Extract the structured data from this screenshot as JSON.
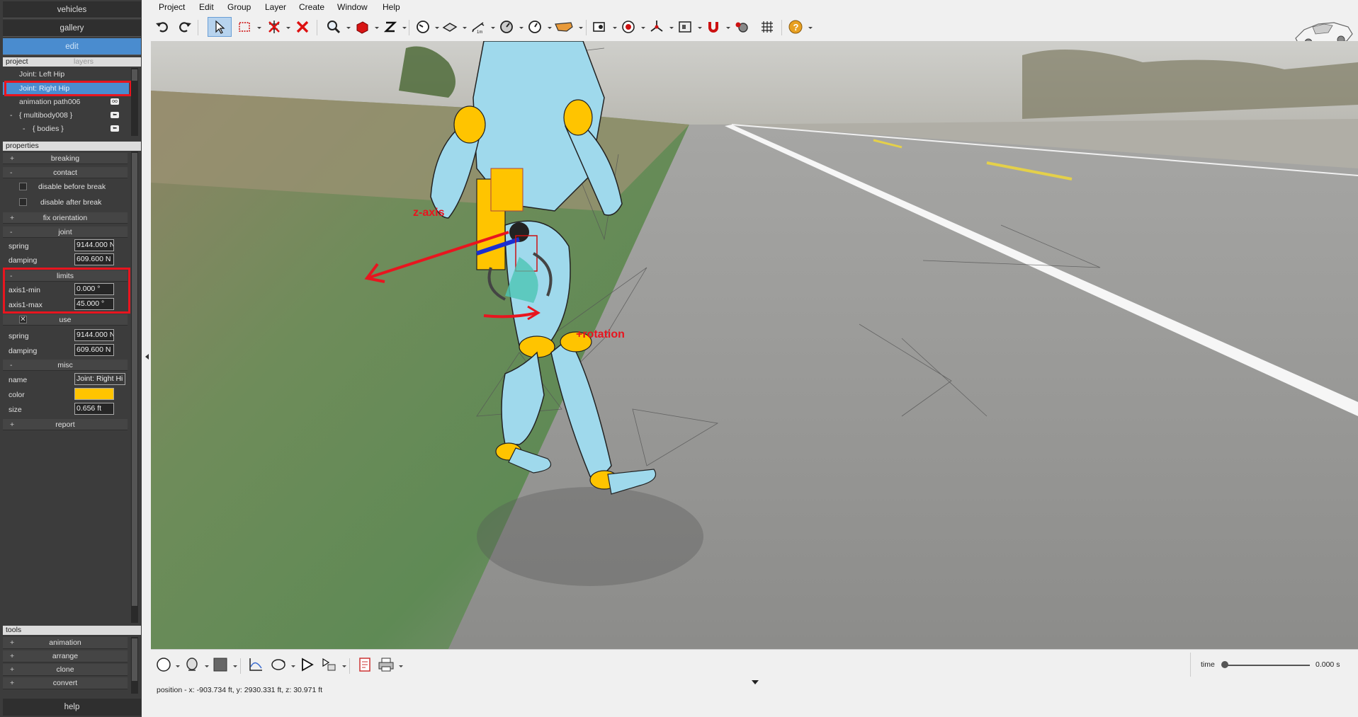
{
  "left_panel": {
    "top_buttons": [
      "vehicles",
      "gallery",
      "edit"
    ],
    "project_header": "project",
    "layers_tab": "layers",
    "tree": [
      {
        "label": "Joint: Left Hip",
        "indent": 1,
        "expander": ""
      },
      {
        "label": "Joint: Right Hip",
        "indent": 1,
        "expander": "",
        "selected": true
      },
      {
        "label": "animation path006",
        "indent": 1,
        "expander": "",
        "tag": "oo"
      },
      {
        "label": "{ multibody008 }",
        "indent": 1,
        "expander": "-",
        "tag": "⬅"
      },
      {
        "label": "{ bodies }",
        "indent": 2,
        "expander": "-",
        "tag": "⬅"
      }
    ],
    "properties_header": "properties",
    "groups": {
      "breaking": {
        "label": "breaking",
        "pm": "+"
      },
      "contact": {
        "label": "contact",
        "pm": "-"
      },
      "fix_orientation": {
        "label": "fix orientation",
        "pm": "+"
      },
      "joint": {
        "label": "joint",
        "pm": "-"
      },
      "limits": {
        "label": "limits",
        "pm": "-"
      },
      "use": {
        "label": "use"
      },
      "misc": {
        "label": "misc",
        "pm": "-"
      },
      "report": {
        "label": "report",
        "pm": "+"
      }
    },
    "contact": {
      "disable_before_break": "disable before break",
      "disable_after_break": "disable after break"
    },
    "joint": {
      "spring_label": "spring",
      "spring_value": "9144.000 N",
      "damping_label": "damping",
      "damping_value": "609.600 N"
    },
    "limits": {
      "min_label": "axis1-min",
      "min_value": "0.000 °",
      "max_label": "axis1-max",
      "max_value": "45.000 °",
      "use_checkbox": "✕",
      "spring_label": "spring",
      "spring_value": "9144.000 N",
      "damping_label": "damping",
      "damping_value": "609.600 N"
    },
    "misc": {
      "name_label": "name",
      "name_value": "Joint: Right Hi",
      "color_label": "color",
      "color_value": "#ffc400",
      "size_label": "size",
      "size_value": "0.656 ft"
    },
    "tools_header": "tools",
    "tools": [
      {
        "label": "animation",
        "pm": "+"
      },
      {
        "label": "arrange",
        "pm": "+"
      },
      {
        "label": "clone",
        "pm": "+"
      },
      {
        "label": "convert",
        "pm": "+"
      }
    ],
    "help": "help"
  },
  "menu": [
    "Project",
    "Edit",
    "Group",
    "Layer",
    "Create",
    "Window",
    "Help"
  ],
  "toolbar_icons": [
    "undo-icon",
    "redo-icon",
    "select-pointer-icon",
    "select-box-icon",
    "delete-node-icon",
    "delete-icon",
    "zoom-icon",
    "solid-shading-icon",
    "z-axis-icon",
    "gauge-icon",
    "surface-icon",
    "measure-icon",
    "dial-icon",
    "clock-icon",
    "vehicle-icon",
    "camera-icon",
    "target-icon",
    "axis-gizmo-icon",
    "frame-icon",
    "magnet-icon",
    "gears-icon",
    "grid-icon",
    "help-icon"
  ],
  "annotations": {
    "z_axis": "z-axis",
    "rotation": "+rotation"
  },
  "colors": {
    "accent": "#4a8ccf",
    "annotation_red": "#e8151f",
    "joint_yellow": "#ffc400",
    "body_blue": "#9fd9ec"
  },
  "bottom": {
    "time_label": "time",
    "time_value": "0.000 s",
    "time_fraction": 0,
    "status": "position - x: -903.734 ft, y: 2930.331 ft, z: 30.971 ft"
  }
}
